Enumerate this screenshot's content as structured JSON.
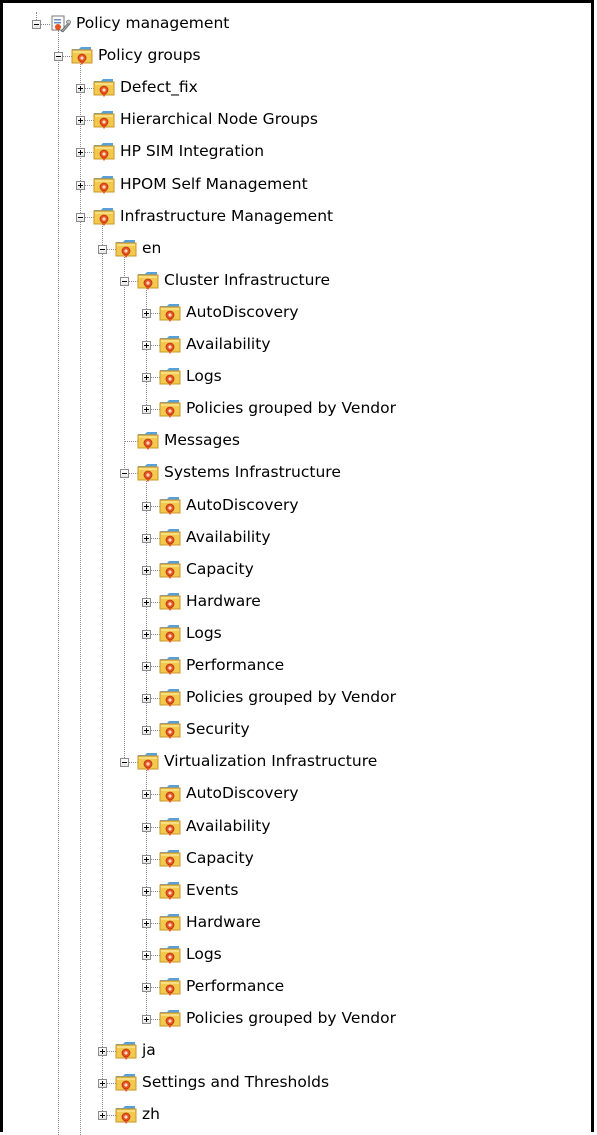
{
  "tree": {
    "root": {
      "label": "Policy management",
      "icon": "policy-management-icon",
      "children": [
        {
          "label": "Policy groups",
          "icon": "policy-group-folder-icon",
          "children": [
            {
              "label": "Defect_fix",
              "icon": "policy-group-folder-icon",
              "collapsed": true
            },
            {
              "label": "Hierarchical Node Groups",
              "icon": "policy-group-folder-icon",
              "collapsed": true
            },
            {
              "label": "HP SIM Integration",
              "icon": "policy-group-folder-icon",
              "collapsed": true
            },
            {
              "label": "HPOM Self Management",
              "icon": "policy-group-folder-icon",
              "collapsed": true
            },
            {
              "label": "Infrastructure Management",
              "icon": "policy-group-folder-icon",
              "children": [
                {
                  "label": "en",
                  "icon": "policy-group-folder-icon",
                  "children": [
                    {
                      "label": "Cluster Infrastructure",
                      "icon": "policy-group-folder-icon",
                      "children": [
                        {
                          "label": "AutoDiscovery",
                          "icon": "policy-group-folder-icon",
                          "collapsed": true
                        },
                        {
                          "label": "Availability",
                          "icon": "policy-group-folder-icon",
                          "collapsed": true
                        },
                        {
                          "label": "Logs",
                          "icon": "policy-group-folder-icon",
                          "collapsed": true
                        },
                        {
                          "label": "Policies grouped by Vendor",
                          "icon": "policy-group-folder-icon",
                          "collapsed": true
                        }
                      ]
                    },
                    {
                      "label": "Messages",
                      "icon": "policy-group-folder-icon"
                    },
                    {
                      "label": "Systems Infrastructure",
                      "icon": "policy-group-folder-icon",
                      "children": [
                        {
                          "label": "AutoDiscovery",
                          "icon": "policy-group-folder-icon",
                          "collapsed": true
                        },
                        {
                          "label": "Availability",
                          "icon": "policy-group-folder-icon",
                          "collapsed": true
                        },
                        {
                          "label": "Capacity",
                          "icon": "policy-group-folder-icon",
                          "collapsed": true
                        },
                        {
                          "label": "Hardware",
                          "icon": "policy-group-folder-icon",
                          "collapsed": true
                        },
                        {
                          "label": "Logs",
                          "icon": "policy-group-folder-icon",
                          "collapsed": true
                        },
                        {
                          "label": "Performance",
                          "icon": "policy-group-folder-icon",
                          "collapsed": true
                        },
                        {
                          "label": "Policies grouped by Vendor",
                          "icon": "policy-group-folder-icon",
                          "collapsed": true
                        },
                        {
                          "label": "Security",
                          "icon": "policy-group-folder-icon",
                          "collapsed": true
                        }
                      ]
                    },
                    {
                      "label": "Virtualization Infrastructure",
                      "icon": "policy-group-folder-icon",
                      "children": [
                        {
                          "label": "AutoDiscovery",
                          "icon": "policy-group-folder-icon",
                          "collapsed": true
                        },
                        {
                          "label": "Availability",
                          "icon": "policy-group-folder-icon",
                          "collapsed": true
                        },
                        {
                          "label": "Capacity",
                          "icon": "policy-group-folder-icon",
                          "collapsed": true
                        },
                        {
                          "label": "Events",
                          "icon": "policy-group-folder-icon",
                          "collapsed": true
                        },
                        {
                          "label": "Hardware",
                          "icon": "policy-group-folder-icon",
                          "collapsed": true
                        },
                        {
                          "label": "Logs",
                          "icon": "policy-group-folder-icon",
                          "collapsed": true
                        },
                        {
                          "label": "Performance",
                          "icon": "policy-group-folder-icon",
                          "collapsed": true
                        },
                        {
                          "label": "Policies grouped by Vendor",
                          "icon": "policy-group-folder-icon",
                          "collapsed": true
                        }
                      ]
                    }
                  ]
                },
                {
                  "label": "ja",
                  "icon": "policy-group-folder-icon",
                  "collapsed": true
                },
                {
                  "label": "Settings and Thresholds",
                  "icon": "policy-group-folder-icon",
                  "collapsed": true
                },
                {
                  "label": "zh",
                  "icon": "policy-group-folder-icon",
                  "collapsed": true
                }
              ]
            }
          ]
        }
      ]
    },
    "colors": {
      "folder": "#f2c94c",
      "folder_dark": "#c9962a",
      "folder_tab": "#5aa0d8",
      "badge": "#e8541e",
      "connector": "#8a8a8a"
    }
  }
}
